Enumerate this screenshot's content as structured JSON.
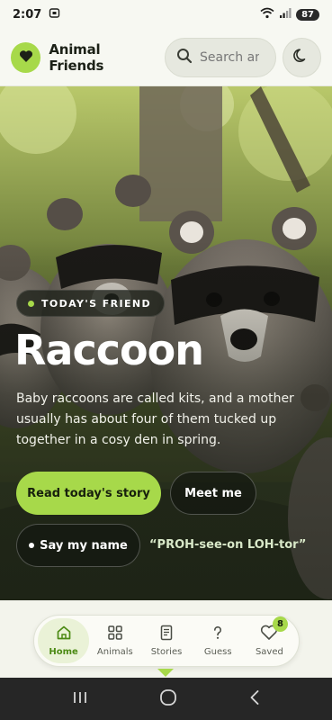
{
  "status_bar": {
    "time": "2:07",
    "battery": "87"
  },
  "header": {
    "brand": "Animal Friends",
    "search_placeholder": "Search animals",
    "theme_toggle_icon": "moon-icon",
    "logo_icon": "heart-icon"
  },
  "hero": {
    "badge": "TODAY'S FRIEND",
    "title": "Raccoon",
    "description": "Baby raccoons are called kits, and a mother usually has about four of them tucked up together in a cosy den in spring.",
    "primary_button": "Read today's story",
    "secondary_button": "Meet me",
    "say_button": "Say my name",
    "pronunciation": "“PROH-see-on LOH-tor”"
  },
  "nav": {
    "items": [
      {
        "label": "Home",
        "icon": "home-icon",
        "active": true
      },
      {
        "label": "Animals",
        "icon": "grid-icon"
      },
      {
        "label": "Stories",
        "icon": "book-icon"
      },
      {
        "label": "Guess",
        "icon": "question-icon"
      },
      {
        "label": "Saved",
        "icon": "heart-icon",
        "badge": "8"
      }
    ]
  },
  "colors": {
    "accent": "#a7d94a",
    "dark": "#1c2117"
  }
}
